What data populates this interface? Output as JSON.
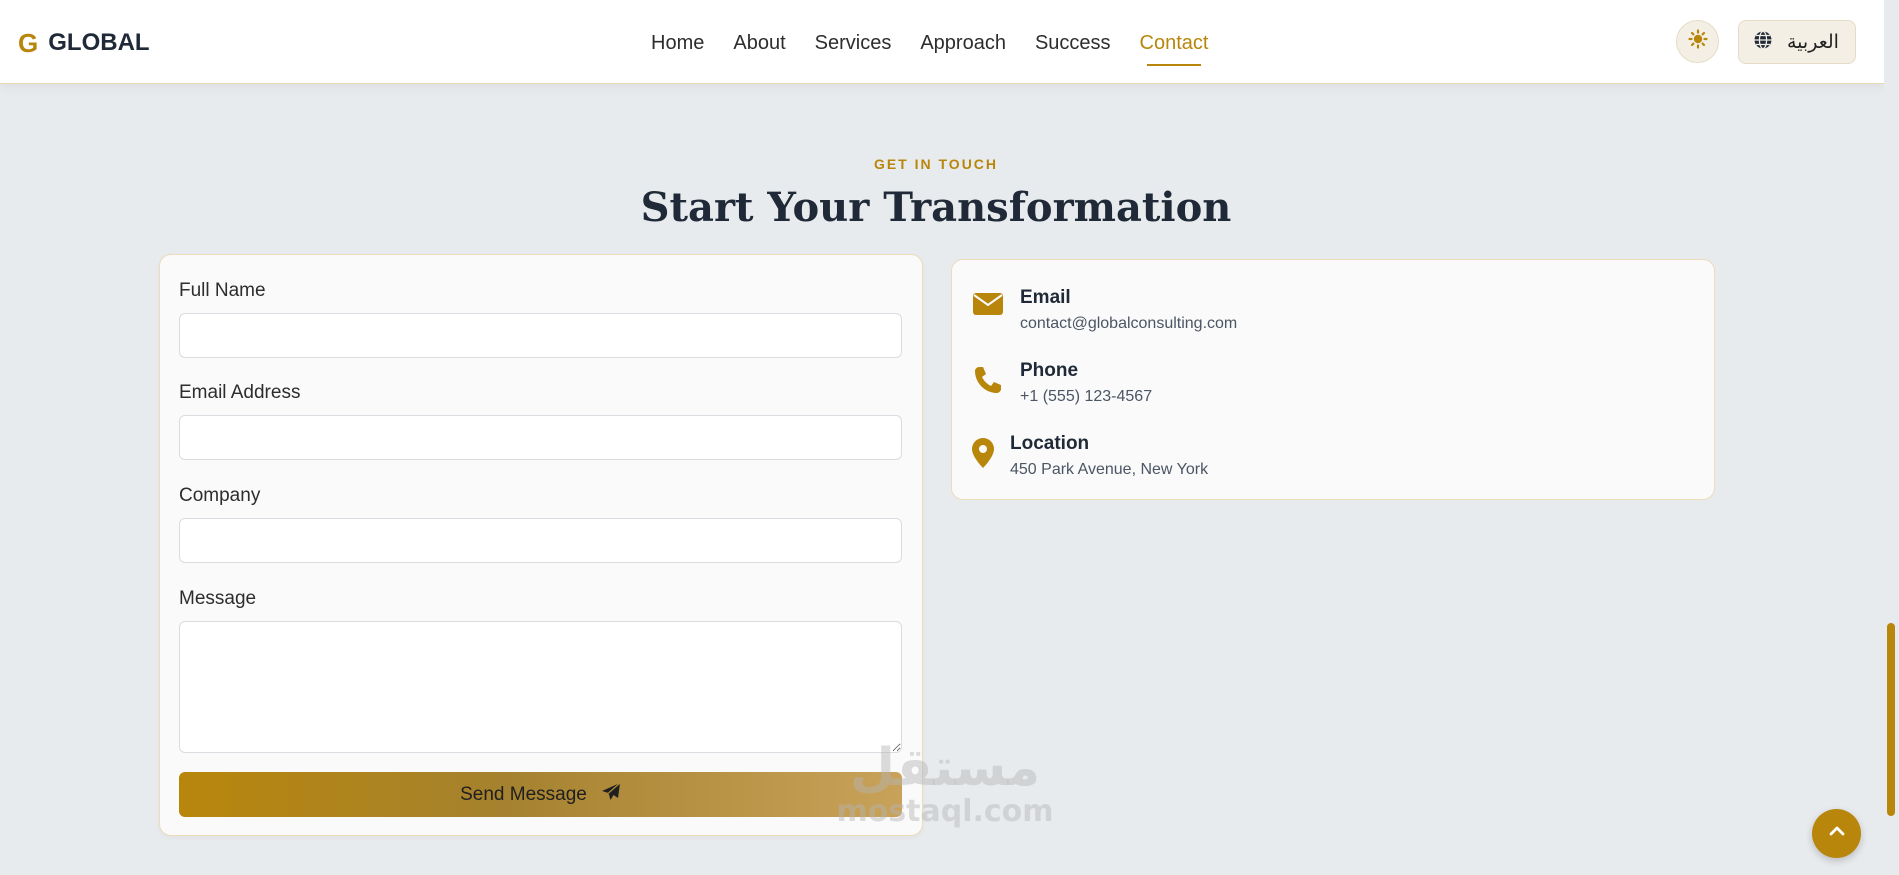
{
  "header": {
    "logo_mark": "G",
    "logo_text": "GLOBAL",
    "nav": [
      {
        "label": "Home",
        "active": false
      },
      {
        "label": "About",
        "active": false
      },
      {
        "label": "Services",
        "active": false
      },
      {
        "label": "Approach",
        "active": false
      },
      {
        "label": "Success",
        "active": false
      },
      {
        "label": "Contact",
        "active": true
      }
    ],
    "theme_icon": "sun-icon",
    "language_label": "العربية",
    "language_icon": "globe-icon"
  },
  "section": {
    "eyebrow": "GET IN TOUCH",
    "title": "Start Your Transformation"
  },
  "form": {
    "fields": [
      {
        "label": "Full Name",
        "value": "",
        "placeholder": ""
      },
      {
        "label": "Email Address",
        "value": "",
        "placeholder": ""
      },
      {
        "label": "Company",
        "value": "",
        "placeholder": ""
      }
    ],
    "message": {
      "label": "Message",
      "value": "",
      "placeholder": ""
    },
    "submit_label": "Send Message",
    "submit_icon": "paper-plane-icon"
  },
  "contact_info": [
    {
      "title": "Email",
      "value": "contact@globalconsulting.com",
      "icon": "envelope-icon"
    },
    {
      "title": "Phone",
      "value": "+1 (555) 123-4567",
      "icon": "phone-icon"
    },
    {
      "title": "Location",
      "value": "450 Park Avenue, New York",
      "icon": "map-pin-icon"
    }
  ],
  "watermark": {
    "arabic": "مستقل",
    "latin": "mostaql.com"
  },
  "colors": {
    "accent": "#b8860b",
    "background": "#e8ebee",
    "card": "#fafafa"
  },
  "back_to_top_icon": "chevron-up-icon"
}
